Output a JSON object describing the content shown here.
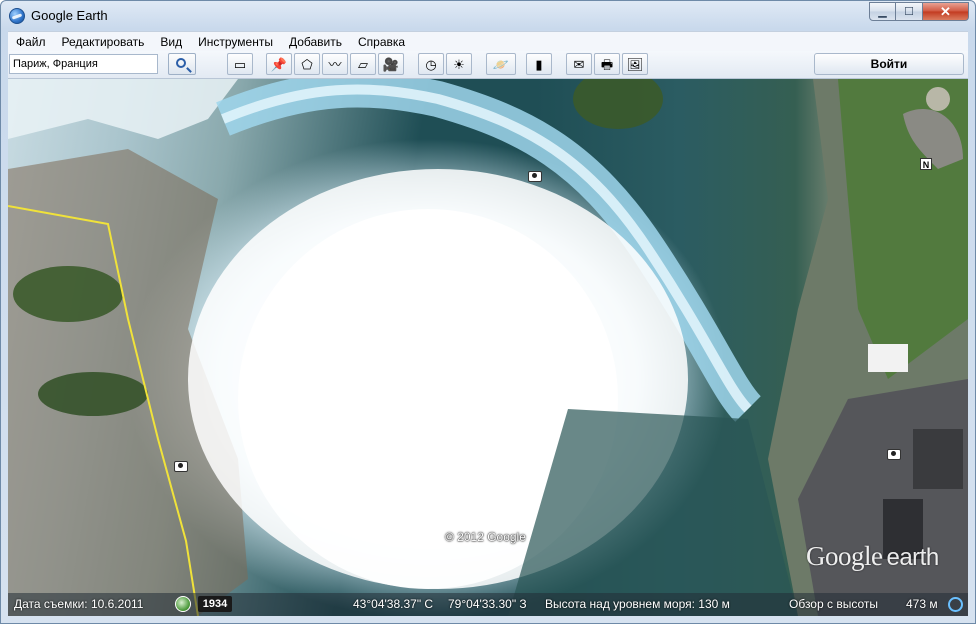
{
  "window": {
    "title": "Google Earth",
    "controls": {
      "minimize": "▁",
      "maximize": "☐",
      "close": "✕"
    }
  },
  "menu": [
    "Файл",
    "Редактировать",
    "Вид",
    "Инструменты",
    "Добавить",
    "Справка"
  ],
  "toolbar": {
    "search_value": "Париж, Франция",
    "signin_label": "Войти",
    "buttons": [
      {
        "name": "sidebar-toggle-icon",
        "glyph": "▭"
      },
      {
        "name": "add-placemark-icon",
        "glyph": "📌"
      },
      {
        "name": "add-polygon-icon",
        "glyph": "⬠"
      },
      {
        "name": "add-path-icon",
        "glyph": "〰"
      },
      {
        "name": "add-image-overlay-icon",
        "glyph": "▱"
      },
      {
        "name": "record-tour-icon",
        "glyph": "🎥"
      },
      {
        "name": "historical-imagery-icon",
        "glyph": "◷"
      },
      {
        "name": "sunlight-icon",
        "glyph": "☀"
      },
      {
        "name": "switch-planet-icon",
        "glyph": "🪐"
      },
      {
        "name": "ruler-icon",
        "glyph": "▮"
      },
      {
        "name": "email-icon",
        "glyph": "✉"
      },
      {
        "name": "print-icon",
        "glyph": "🖶"
      },
      {
        "name": "save-image-icon",
        "glyph": "🖼"
      }
    ]
  },
  "map": {
    "copyright": "© 2012 Google",
    "logo_google": "Google",
    "logo_earth": "earth",
    "north_label": "N",
    "boundary_color": "#f0e23a"
  },
  "status": {
    "imagery_date": "Дата съемки: 10.6.2011",
    "historical_year": "1934",
    "latitude": "43°04'38.37\" С",
    "longitude": "79°04'33.30\" З",
    "elevation": "Высота над уровнем моря:   130 м",
    "eye_alt_label": "Обзор с высоты",
    "eye_alt_value": "473 м"
  }
}
